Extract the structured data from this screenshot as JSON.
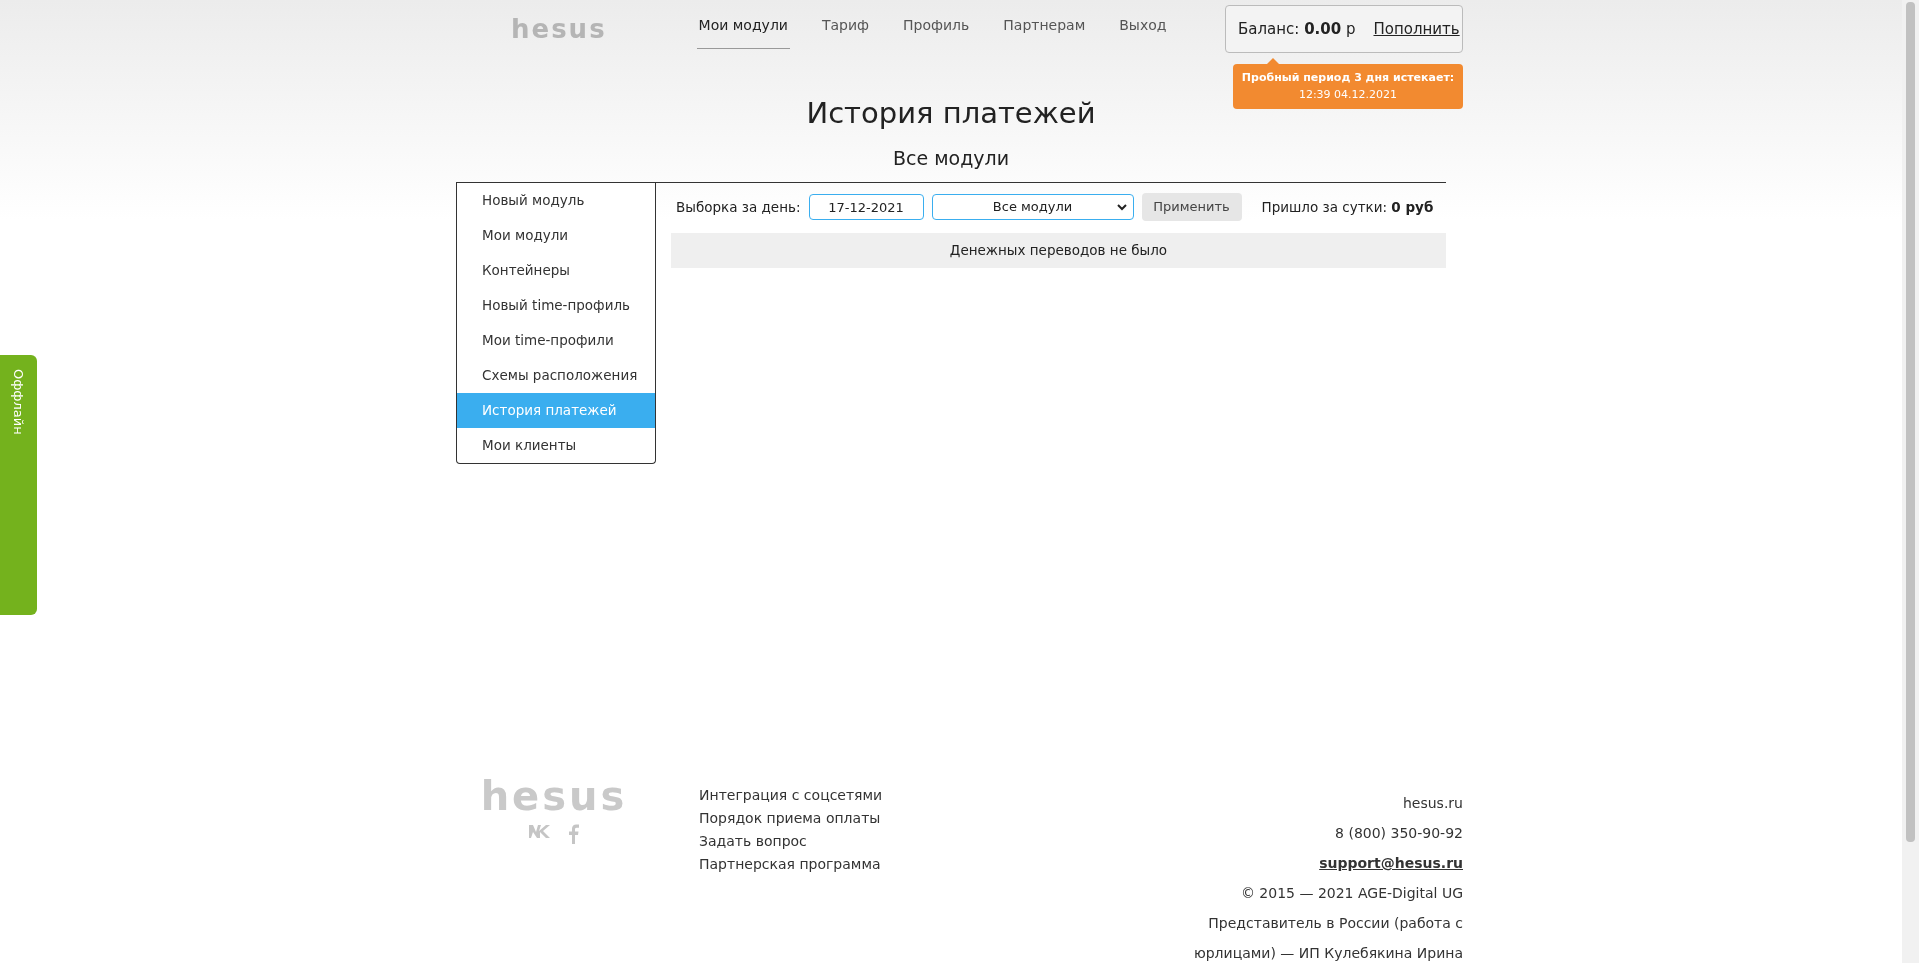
{
  "header": {
    "logo": "hesus",
    "nav": [
      {
        "label": "Мои модули",
        "selected": true
      },
      {
        "label": "Тариф",
        "selected": false
      },
      {
        "label": "Профиль",
        "selected": false
      },
      {
        "label": "Партнерам",
        "selected": false
      },
      {
        "label": "Выход",
        "selected": false
      }
    ],
    "balance": {
      "label": "Баланс:",
      "amount": "0.00",
      "currency": "р",
      "topup": "Пополнить"
    },
    "trial_notice": {
      "title": "Пробный период 3 дня истекает:",
      "date": "12:39 04.12.2021"
    }
  },
  "page_title": "История платежей",
  "subtitle": "Все модули",
  "sidebar": {
    "items": [
      {
        "label": "Новый модуль",
        "selected": false
      },
      {
        "label": "Мои модули",
        "selected": false
      },
      {
        "label": "Контейнеры",
        "selected": false
      },
      {
        "label": "Новый time-профиль",
        "selected": false
      },
      {
        "label": "Мои time-профили",
        "selected": false
      },
      {
        "label": "Схемы расположения",
        "selected": false
      },
      {
        "label": "История платежей",
        "selected": true
      },
      {
        "label": "Мои клиенты",
        "selected": false
      }
    ]
  },
  "filter": {
    "date_label": "Выборка за день:",
    "date_value": "17-12-2021",
    "module_select": "Все модули",
    "apply_button": "Применить",
    "total_label": "Пришло за сутки:",
    "total_value": "0 руб"
  },
  "empty_message": "Денежных переводов не было",
  "status_tab": "Оффлайн",
  "footer": {
    "logo": "hesus",
    "links": [
      "Интеграция с соцсетями",
      "Порядок приема оплаты",
      "Задать вопрос",
      "Партнерская программа"
    ],
    "site": "hesus.ru",
    "phone": "8 (800) 350-90-92",
    "email": "support@hesus.ru",
    "copyright": "© 2015 — 2021 AGE-Digital UG",
    "representative": [
      "Представитель в России (работа с",
      "юрлицами) — ИП Кулебякина Ирина"
    ]
  }
}
